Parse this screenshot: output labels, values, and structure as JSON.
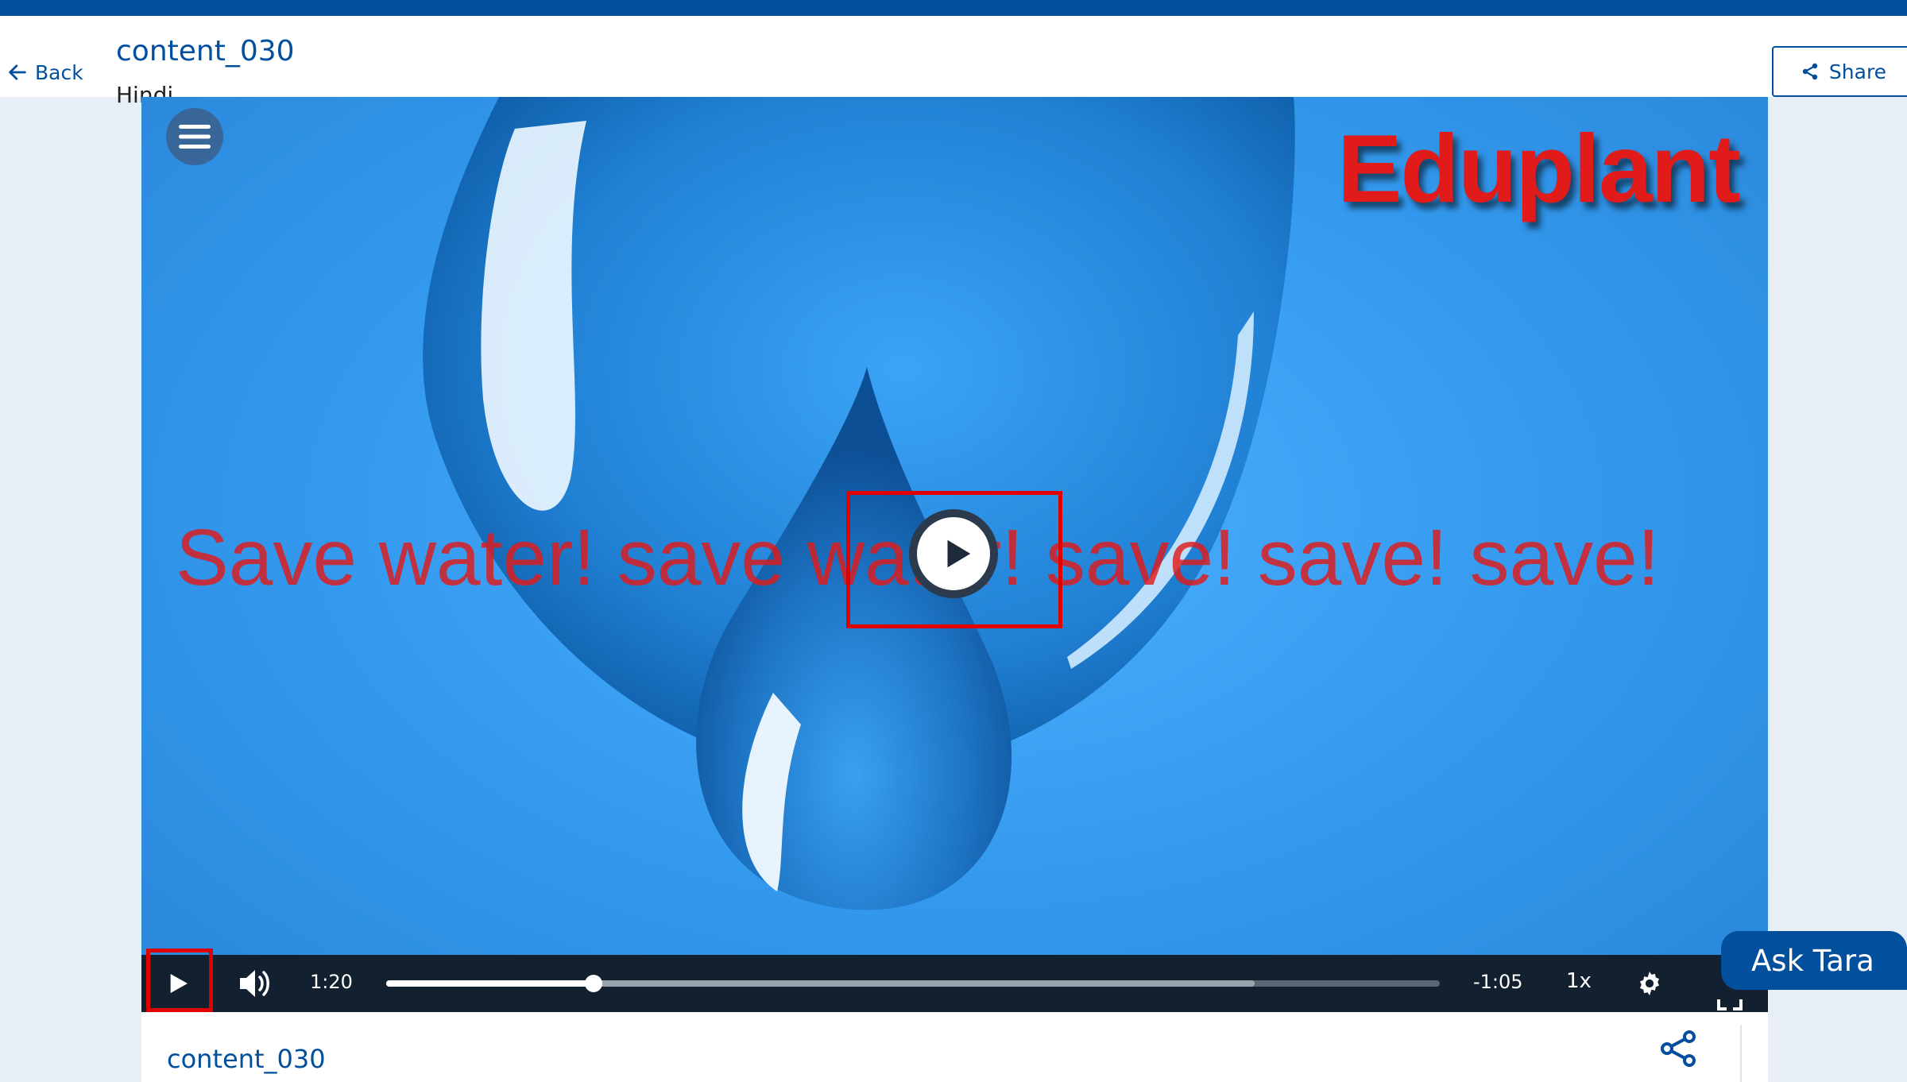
{
  "header": {
    "back_label": "Back",
    "title": "content_030",
    "language": "Hindi",
    "share_label": "Share"
  },
  "video": {
    "brand": "Eduplant",
    "caption": "Save water! save water! save! save! save!",
    "current_time": "1:20",
    "remaining_time": "-1:05",
    "played_fraction": 0.197,
    "buffered_fraction": 0.824,
    "speed": "1x",
    "state": "paused"
  },
  "assistant": {
    "label": "Ask Tara"
  },
  "details": {
    "title": "content_030"
  },
  "colors": {
    "brand_blue": "#024f9d",
    "caption_red": "#e11a1a",
    "highlight_red": "#e00000",
    "controls_bg": "#13202f"
  },
  "icons": [
    "arrow-left-icon",
    "share-icon",
    "hamburger-menu-icon",
    "play-icon",
    "volume-icon",
    "settings-gear-icon",
    "fullscreen-icon"
  ]
}
